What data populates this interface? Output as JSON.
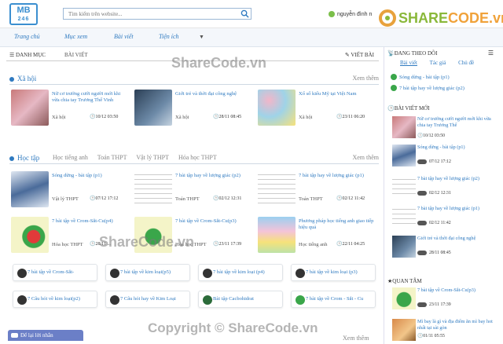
{
  "header": {
    "logo_line1": "MB",
    "logo_line2": "246",
    "search_placeholder": "Tìm kiếm trên website...",
    "user_name": "nguyễn đình n",
    "brand_a": "SHARE",
    "brand_b": "CODE.vn"
  },
  "nav": {
    "items": [
      "Trang chủ",
      "Mục xem",
      "Bài viết",
      "Tiện ích"
    ]
  },
  "catbar": {
    "danh_muc": "DANH MỤC",
    "bai_viet": "BÀI VIẾT",
    "viet_bai": "VIẾT BÀI"
  },
  "section1": {
    "title": "Xã hội",
    "more": "Xem thêm",
    "cards": [
      {
        "title": "Nữ cơ trưởng cưới người mới khi vừa chia tay Trương Thế Vinh",
        "cat": "Xã hội",
        "date": "10/12 03:50"
      },
      {
        "title": "Giới trẻ và thời đại công nghệ",
        "cat": "Xã hội",
        "date": "28/11 08:45"
      },
      {
        "title": "Xổ số kiểu Mỹ tại Việt Nam",
        "cat": "Xã hội",
        "date": "23/11 06:20"
      }
    ]
  },
  "section2": {
    "title": "Học tập",
    "tabs": [
      "Học tiếng anh",
      "Toán THPT",
      "Vật lý THPT",
      "Hóa học THPT"
    ],
    "more": "Xem thêm",
    "cards": [
      {
        "title": "Sóng dừng - bài tập (p1)",
        "cat": "Vật lý THPT",
        "date": "07/12 17:12"
      },
      {
        "title": "7 bài tập hay về lượng giác (p2)",
        "cat": "Toán THPT",
        "date": "02/12 12:31"
      },
      {
        "title": "7 bài tập hay về lượng giác (p1)",
        "cat": "Toán THPT",
        "date": "02/12 11:42"
      },
      {
        "title": "7 bài tập về Crom-Sắt-Cu(p4)",
        "cat": "Hóa học THPT",
        "date": "28/11 ..."
      },
      {
        "title": "7 bài tập về Crom-Sắt-Cu(p3)",
        "cat": "Hóa học THPT",
        "date": "23/11 17:39"
      },
      {
        "title": "Phương pháp học tiếng anh giao tiếp hiệu quả",
        "cat": "Học tiếng anh",
        "date": "22/11 04:25"
      }
    ],
    "pills": [
      "7 bài tập về Crom-Sắt-",
      "7 bài tập về kim loại(p5)",
      "7 bài tập về kim loại (p4)",
      "7 bài tập về kim loại (p3)",
      "7 Câu hỏi về kim loại(p2)",
      "7 Câu hỏi hay về Kim Loại",
      "Bài tập Cacbohidrat",
      "7 bài tập về Crom - Sắt - Cu"
    ],
    "bottom_more": "Xem thêm"
  },
  "sidebar": {
    "following_title": "ĐANG THEO DÕI",
    "tabs": [
      "Bài viết",
      "Tác giả",
      "Chủ đề"
    ],
    "following": [
      "Sóng dừng - bài tập (p1)",
      "7 bài tập hay về lượng giác (p2)"
    ],
    "new_title": "BÀI VIẾT MỚI",
    "new_items": [
      {
        "title": "Nữ cơ trưởng cưới người mới khi vừa chia tay Trương Thế",
        "date": "10/12 03:50"
      },
      {
        "title": "Sóng dừng - bài tập (p1)",
        "date": "07/12 17:12"
      },
      {
        "title": "7 bài tập hay về lượng giác (p2)",
        "date": "02/12 12:31"
      },
      {
        "title": "7 bài tập hay về lượng giác (p1)",
        "date": "02/12 11:42"
      },
      {
        "title": "Giới trẻ và thời đại công nghệ",
        "date": "28/11 08:45"
      }
    ],
    "interest_title": "QUAN TÂM",
    "interest_items": [
      {
        "title": "7 bài tập về Crom-Sắt-Cu(p3)",
        "date": "23/11 17:39"
      },
      {
        "title": "Mì bay là gì và địa điểm ăn mì bay hot nhất tại sài gòn",
        "date": "01/11 05:55"
      }
    ]
  },
  "chat_label": "Để lại lời nhắn",
  "watermark": "ShareCode.vn",
  "copyright": "Copyright © ShareCode.vn"
}
